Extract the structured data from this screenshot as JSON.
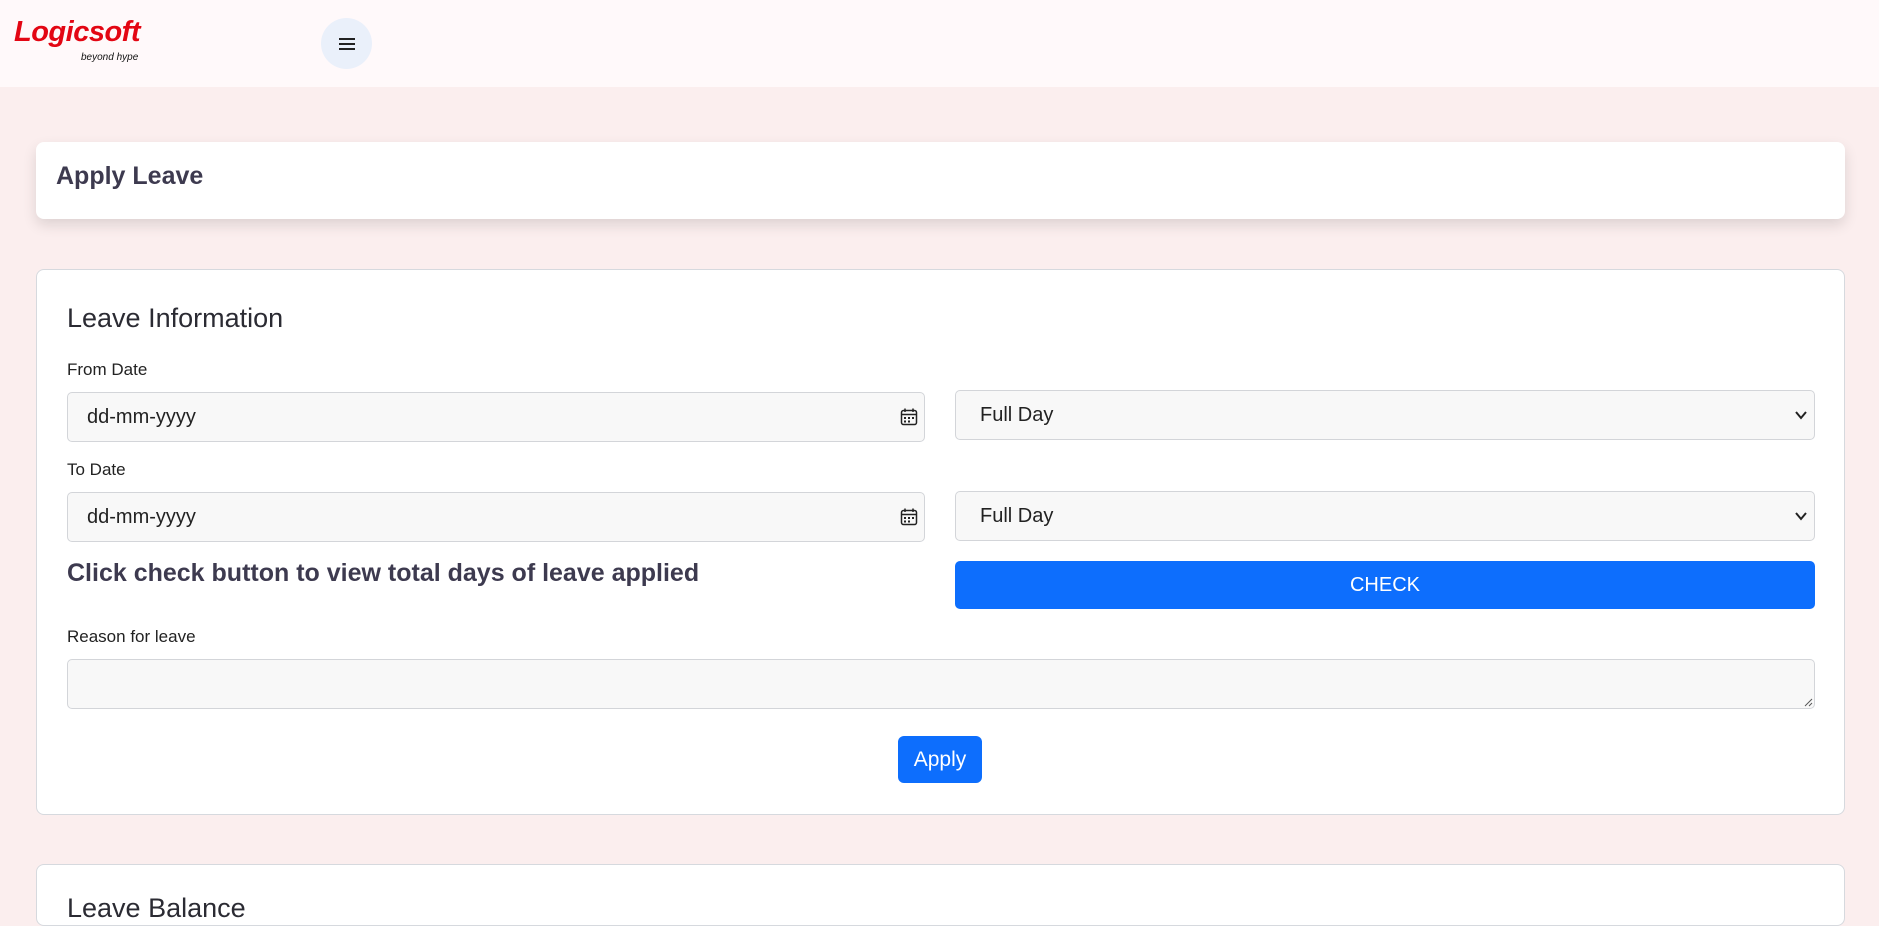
{
  "brand": {
    "name": "Logicsoft",
    "tagline": "beyond hype",
    "color": "#e30613"
  },
  "header": {
    "menu_icon": "hamburger-menu-icon"
  },
  "page": {
    "title": "Apply Leave"
  },
  "leave_info": {
    "title": "Leave Information",
    "from_date": {
      "label": "From Date",
      "value": "dd-mm-yyyy",
      "icon": "calendar-icon",
      "duration": "Full Day"
    },
    "to_date": {
      "label": "To Date",
      "value": "dd-mm-yyyy",
      "icon": "calendar-icon",
      "duration": "Full Day"
    },
    "check_hint": "Click check button to view total days of leave applied",
    "check_button": "CHECK",
    "reason_label": "Reason for leave",
    "reason_value": "",
    "apply_button": "Apply"
  },
  "next_section": {
    "title": "Leave Balance"
  },
  "colors": {
    "primary": "#0d6efd",
    "background": "#fbeeee"
  }
}
